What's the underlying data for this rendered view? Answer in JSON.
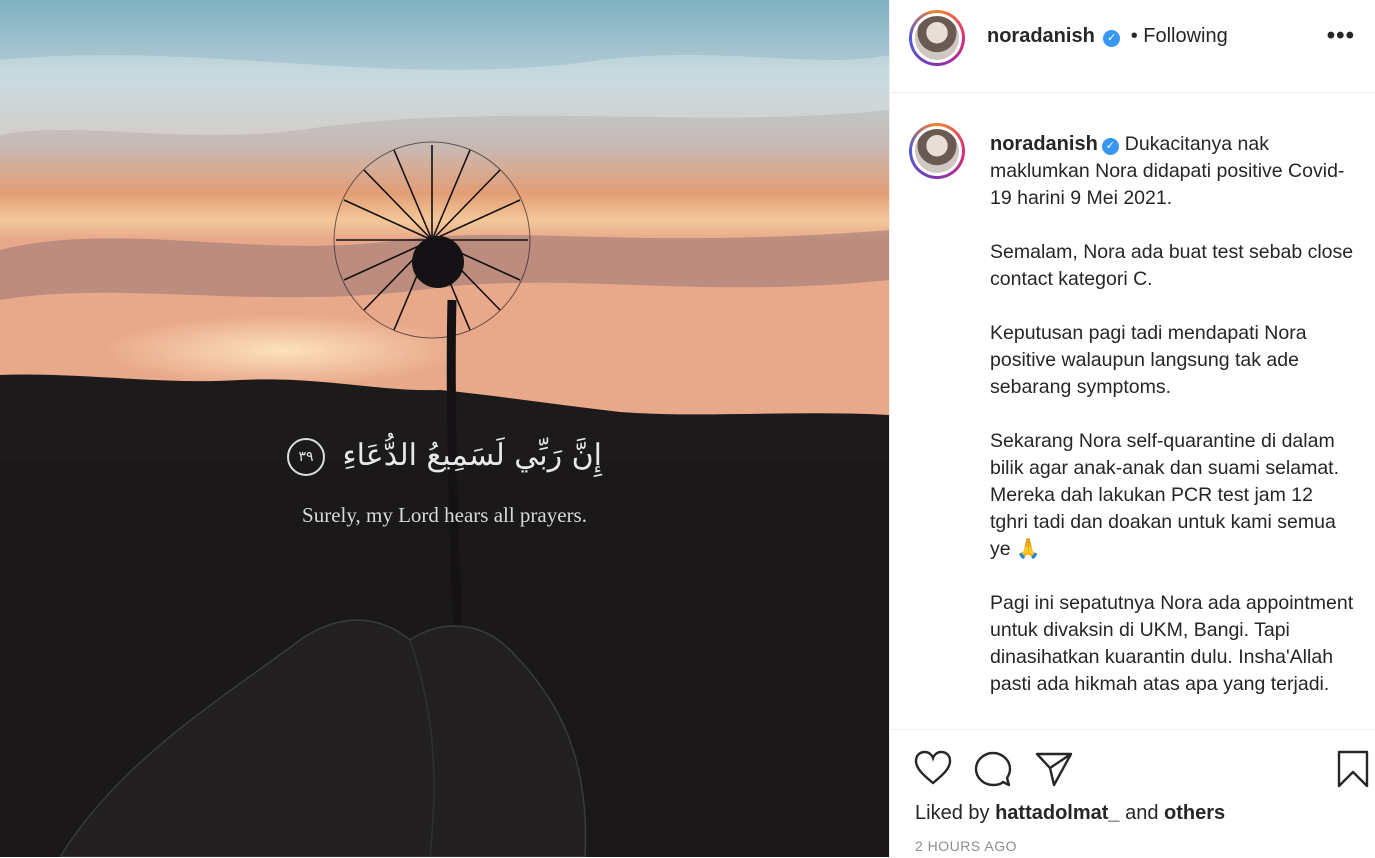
{
  "post": {
    "image": {
      "quote_arabic": "إِنَّ رَبِّي لَسَمِيعُ الدُّعَاءِ",
      "ayah_number": "٣٩",
      "quote_english": "Surely, my Lord hears all prayers."
    },
    "header": {
      "username": "noradanish",
      "verified_mark": "✓",
      "follow_status": "• Following",
      "more_label": "•••"
    },
    "caption": {
      "username": "noradanish",
      "text": "Dukacitanya nak maklumkan Nora didapati positive Covid-19 harini 9 Mei 2021.\n\nSemalam, Nora ada buat test sebab close contact kategori C.\n\nKeputusan pagi tadi mendapati Nora positive walaupun langsung tak ade sebarang symptoms.\n\nSekarang Nora self-quarantine di dalam bilik agar anak-anak dan suami selamat. Mereka dah lakukan PCR test jam 12 tghri tadi dan doakan untuk kami semua ye 🙏\n\nPagi ini sepatutnya Nora ada appointment untuk divaksin di UKM, Bangi. Tapi dinasihatkan kuarantin dulu. Insha'Allah pasti ada hikmah atas apa yang terjadi."
    },
    "actions": {
      "icons": [
        "heart-icon",
        "comment-icon",
        "share-icon",
        "bookmark-icon"
      ]
    },
    "likes": {
      "prefix": "Liked by",
      "user": "hattadolmat_",
      "connector": "and",
      "others": "others"
    },
    "timestamp": "2 HOURS AGO"
  }
}
